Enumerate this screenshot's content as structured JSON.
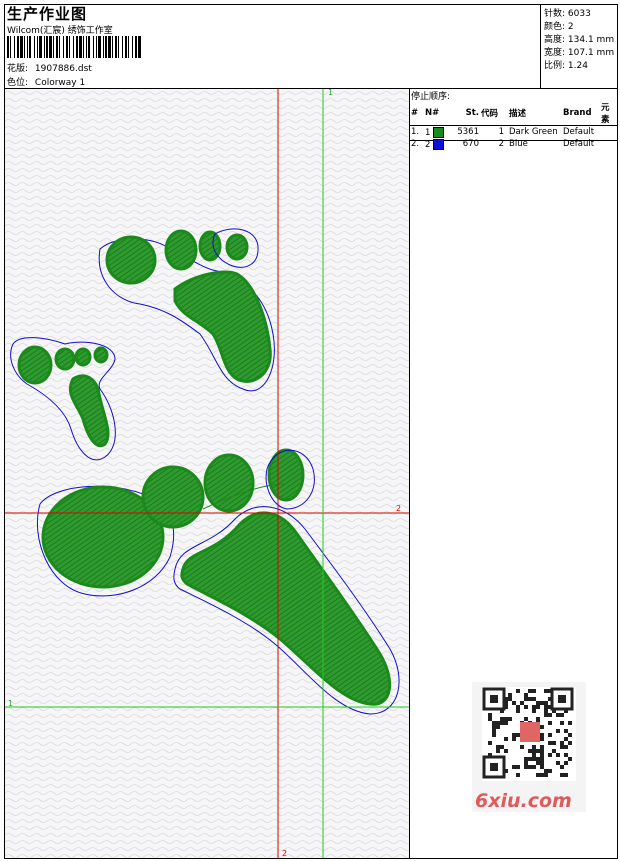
{
  "header": {
    "title": "生产作业图",
    "studio": "Wilcom(汇宸) 绣饰工作室",
    "design_label": "花版:",
    "design_file": "1907886.dst",
    "colorway_label": "色位:",
    "colorway": "Colorway 1"
  },
  "info": {
    "stitches_label": "针数:",
    "stitches": "6033",
    "colors_label": "颜色:",
    "colors": "2",
    "height_label": "高度:",
    "height": "134.1 mm",
    "width_label": "宽度:",
    "width": "107.1 mm",
    "scale_label": "比例:",
    "scale": "1.24"
  },
  "stop_sequence": {
    "title": "停止顺序:",
    "columns": [
      "#",
      "N#",
      "St.",
      "代码",
      "描述",
      "Brand",
      "元素"
    ],
    "rows": [
      {
        "num": "1.",
        "n": "1",
        "color": "#1a8a1a",
        "stitches": "5361",
        "code": "1",
        "desc": "Dark Green",
        "brand": "Default"
      },
      {
        "num": "2.",
        "n": "2",
        "color": "#1010d0",
        "stitches": "670",
        "code": "2",
        "desc": "Blue",
        "brand": "Default"
      }
    ]
  },
  "axes": {
    "top_green": "1",
    "left_green": "1",
    "right_red": "2",
    "bottom_red": "2"
  },
  "watermark": {
    "text": "6xiu.com"
  }
}
